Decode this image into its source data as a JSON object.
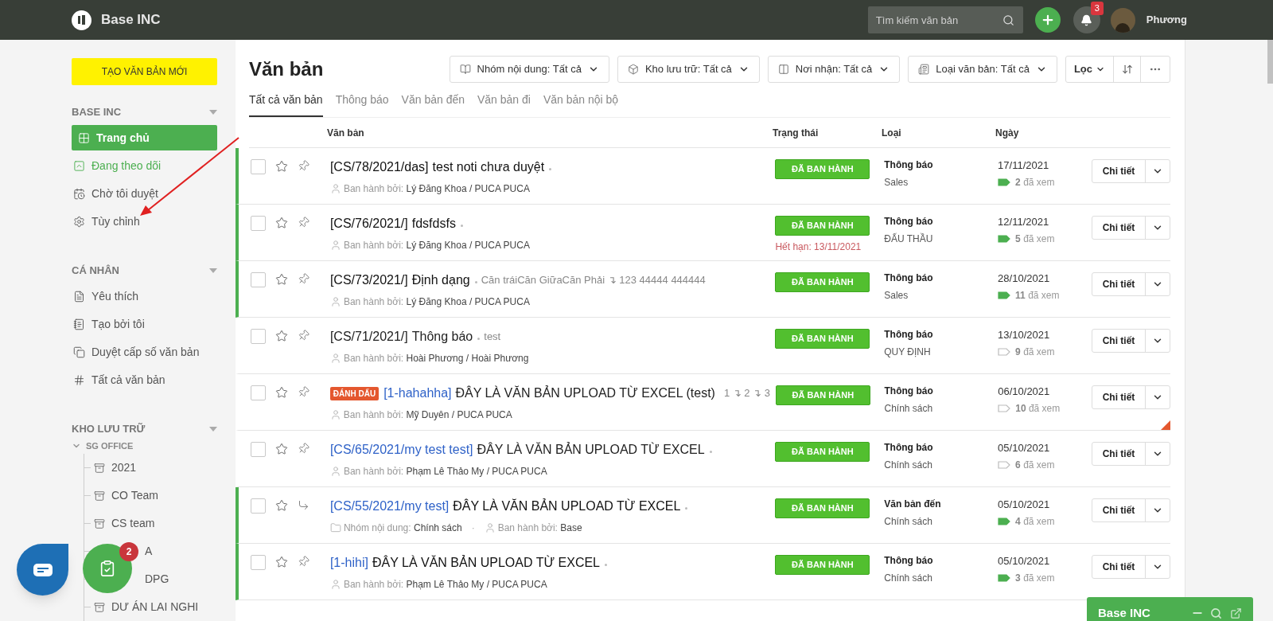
{
  "header": {
    "brand": "Base INC",
    "search": {
      "placeholder": "Tìm kiếm văn bản"
    },
    "notifications": "3",
    "user": "Phương"
  },
  "sidebar": {
    "create_button": "TẠO VĂN BẢN MỚI",
    "sections": [
      {
        "title": "BASE INC",
        "items": [
          {
            "label": "Trang chủ",
            "selected": true,
            "accent": false
          },
          {
            "label": "Đang theo dõi",
            "selected": false,
            "accent": true
          },
          {
            "label": "Chờ tôi duyệt",
            "selected": false,
            "accent": false
          },
          {
            "label": "Tùy chỉnh",
            "selected": false,
            "accent": false
          }
        ]
      },
      {
        "title": "CÁ NHÂN",
        "items": [
          {
            "label": "Yêu thích",
            "selected": false,
            "accent": false
          },
          {
            "label": "Tạo bởi tôi",
            "selected": false,
            "accent": false
          },
          {
            "label": "Duyệt cấp số văn bản",
            "selected": false,
            "accent": false
          },
          {
            "label": "Tất cả văn bản",
            "selected": false,
            "accent": false
          }
        ]
      }
    ],
    "storage": {
      "title": "KHO LƯU TRỮ",
      "group": {
        "label": "SG OFFICE",
        "expanded": true,
        "children": [
          {
            "label": "2021",
            "covered": false
          },
          {
            "label": "CO Team",
            "covered": false
          },
          {
            "label": "CS team",
            "covered": false
          },
          {
            "label": "A",
            "covered": true
          },
          {
            "label": "DPG",
            "covered": true
          },
          {
            "label": "DƯ ÁN LAI NGHI",
            "covered": false
          }
        ]
      }
    }
  },
  "page": {
    "title": "Văn bản",
    "filters": [
      "Nhóm nội dung: Tất cả",
      "Kho lưu trữ: Tất cả",
      "Nơi nhận: Tất cả",
      "Loại văn bản: Tất cả"
    ],
    "filter_button": "Lọc"
  },
  "tabs": [
    {
      "label": "Tất cả văn bản",
      "selected": true
    },
    {
      "label": "Thông báo",
      "selected": false
    },
    {
      "label": "Văn bản đến",
      "selected": false
    },
    {
      "label": "Văn bản đi",
      "selected": false
    },
    {
      "label": "Văn bản nội bộ",
      "selected": false
    }
  ],
  "table": {
    "columns": [
      "Văn bản",
      "Trạng thái",
      "Loại",
      "Ngày"
    ],
    "rows": [
      {
        "checked": false,
        "unread": true,
        "kind": "pin",
        "code": "[CS/78/2021/das]",
        "code_link": false,
        "title": "test noti chưa duyệt",
        "meta": [
          {
            "kind": "issuer",
            "label": "Ban hành bởi:",
            "value": "Lý Đăng Khoa / PUCA PUCA"
          }
        ],
        "status": "ĐÃ BAN HÀNH",
        "type": "Thông báo",
        "category": "Sales",
        "date": "17/11/2021",
        "views": "2",
        "views_label": "đã xem",
        "button": "Chi tiết"
      },
      {
        "checked": false,
        "unread": true,
        "kind": "pin",
        "code": "[CS/76/2021/]",
        "code_link": false,
        "title": "fdsfdsfs",
        "meta": [
          {
            "kind": "issuer",
            "label": "Ban hành bởi:",
            "value": "Lý Đăng Khoa / PUCA PUCA"
          }
        ],
        "status": "ĐÃ BAN HÀNH",
        "expiry": "Hết hạn: 13/11/2021",
        "type": "Thông báo",
        "category": "ĐẤU THẦU",
        "date": "12/11/2021",
        "views": "5",
        "views_label": "đã xem",
        "button": "Chi tiết"
      },
      {
        "checked": false,
        "unread": true,
        "kind": "pin",
        "code": "[CS/73/2021/]",
        "code_link": false,
        "title": "Định dạng",
        "extra": "Căn tráiCăn GiữaCăn Phải ↴ 123 44444 444444",
        "meta": [
          {
            "kind": "issuer",
            "label": "Ban hành bởi:",
            "value": "Lý Đăng Khoa / PUCA PUCA"
          }
        ],
        "status": "ĐÃ BAN HÀNH",
        "type": "Thông báo",
        "category": "Sales",
        "date": "28/10/2021",
        "views": "11",
        "views_label": "đã xem",
        "button": "Chi tiết"
      },
      {
        "checked": false,
        "unread": false,
        "kind": "pin",
        "code": "[CS/71/2021/]",
        "code_link": false,
        "title": "Thông báo",
        "extra": "test",
        "meta": [
          {
            "kind": "issuer",
            "label": "Ban hành bởi:",
            "value": "Hoài Phương / Hoài Phương"
          }
        ],
        "status": "ĐÃ BAN HÀNH",
        "type": "Thông báo",
        "category": "QUY ĐỊNH",
        "date": "13/10/2021",
        "views": "9",
        "views_label": "đã xem",
        "button": "Chi tiết"
      },
      {
        "checked": false,
        "unread": false,
        "kind": "pin",
        "badge": "ĐÁNH DẤU",
        "code": "[1-hahahha]",
        "code_link": true,
        "title": "ĐÂY LÀ VĂN BẢN UPLOAD TỪ EXCEL (test)",
        "extra": "1 ↴ 2 ↴ 3",
        "meta": [
          {
            "kind": "issuer",
            "label": "Ban hành bởi:",
            "value": "Mỹ Duyên / PUCA PUCA"
          }
        ],
        "status": "ĐÃ BAN HÀNH",
        "type": "Thông báo",
        "category": "Chính sách",
        "date": "06/10/2021",
        "views": "10",
        "views_label": "đã xem",
        "button": "Chi tiết"
      },
      {
        "checked": false,
        "unread": false,
        "kind": "pin",
        "code": "[CS/65/2021/my test test]",
        "code_link": true,
        "title": "ĐÂY LÀ VĂN BẢN UPLOAD TỪ EXCEL",
        "meta": [
          {
            "kind": "issuer",
            "label": "Ban hành bởi:",
            "value": "Phạm Lê Thảo My / PUCA PUCA"
          }
        ],
        "status": "ĐÃ BAN HÀNH",
        "type": "Thông báo",
        "category": "Chính sách",
        "date": "05/10/2021",
        "views": "6",
        "views_label": "đã xem",
        "button": "Chi tiết"
      },
      {
        "checked": false,
        "unread": true,
        "kind": "reply",
        "code": "[CS/55/2021/my test]",
        "code_link": true,
        "title": "ĐÂY LÀ VĂN BẢN UPLOAD TỪ EXCEL",
        "meta": [
          {
            "kind": "group",
            "label": "Nhóm nội dung:",
            "value": "Chính sách"
          },
          {
            "kind": "dot",
            "label": "·"
          },
          {
            "kind": "issuer",
            "label": "Ban hành bởi:",
            "value": "Base"
          }
        ],
        "status": "ĐÃ BAN HÀNH",
        "type": "Văn bản đến",
        "category": "Chính sách",
        "date": "05/10/2021",
        "views": "4",
        "views_label": "đã xem",
        "button": "Chi tiết"
      },
      {
        "checked": false,
        "unread": true,
        "kind": "pin",
        "code": "[1-hihi]",
        "code_link": true,
        "title": "ĐÂY LÀ VĂN BẢN UPLOAD TỪ EXCEL",
        "meta": [
          {
            "kind": "issuer",
            "label": "Ban hành bởi:",
            "value": "Phạm Lê Thảo My / PUCA PUCA"
          }
        ],
        "status": "ĐÃ BAN HÀNH",
        "type": "Thông báo",
        "category": "Chính sách",
        "date": "05/10/2021",
        "views": "3",
        "views_label": "đã xem",
        "button": "Chi tiết"
      }
    ]
  },
  "floating": {
    "tasks_badge": "2"
  },
  "chat_panel": {
    "title": "Base INC"
  }
}
